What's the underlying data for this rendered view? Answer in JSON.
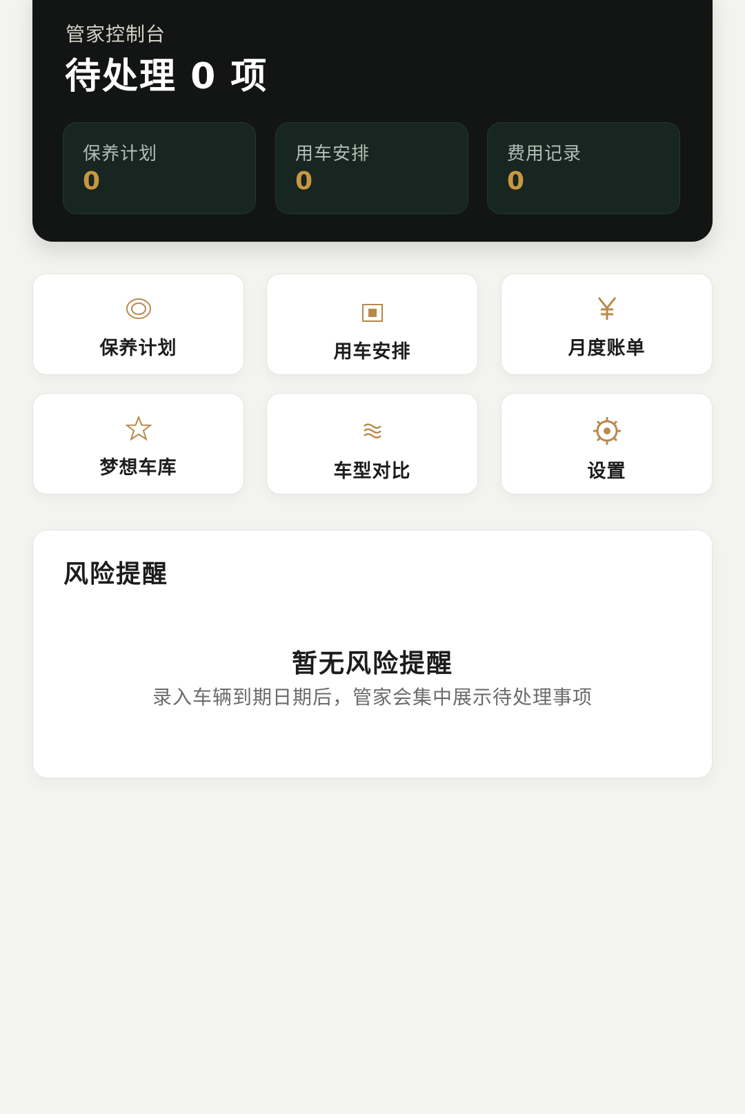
{
  "header": {
    "subtitle": "管家控制台",
    "title": "待处理 0 项"
  },
  "stats": [
    {
      "label": "保养计划",
      "value": "0"
    },
    {
      "label": "用车安排",
      "value": "0"
    },
    {
      "label": "费用记录",
      "value": "0"
    }
  ],
  "tiles": [
    {
      "label": "保养计划",
      "icon": "maintenance-icon"
    },
    {
      "label": "用车安排",
      "icon": "schedule-icon"
    },
    {
      "label": "月度账单",
      "icon": "yen-icon"
    },
    {
      "label": "梦想车库",
      "icon": "star-icon"
    },
    {
      "label": "车型对比",
      "icon": "compare-icon"
    },
    {
      "label": "设置",
      "icon": "settings-icon"
    }
  ],
  "risk": {
    "title": "风险提醒",
    "empty_title": "暂无风险提醒",
    "empty_desc": "录入车辆到期日期后，管家会集中展示待处理事项"
  },
  "colors": {
    "accent": "#b8894b",
    "stat_value": "#c9973f",
    "hero_bg": "#121513",
    "page_bg": "#f3f3f0"
  }
}
